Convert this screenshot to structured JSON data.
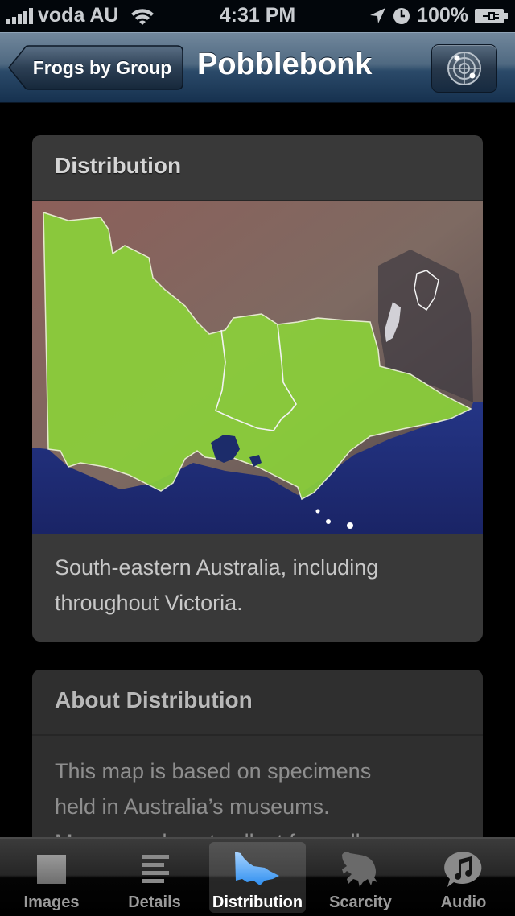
{
  "status_bar": {
    "carrier": "voda AU",
    "time": "4:31 PM",
    "battery": "100%",
    "icons": [
      "signal-bars-icon",
      "wifi-icon",
      "location-arrow-icon",
      "alarm-clock-icon",
      "battery-charging-icon"
    ]
  },
  "nav_bar": {
    "back_label": "Frogs by Group",
    "title": "Pobblebonk",
    "right_button_icon": "radar-icon"
  },
  "distribution_card": {
    "title": "Distribution",
    "map_description": "Distribution map of Victoria, south-eastern Australia, shaded green",
    "text": "South-eastern Australia, including throughout Victoria.",
    "colors": {
      "range_fill": "#8bd13a",
      "sea": "#1d2a6e",
      "land": "#7c6460"
    }
  },
  "about_card": {
    "title": "About Distribution",
    "text_lines": [
      "This map is based on specimens",
      "held in Australia’s museums.",
      "Museums do not collect from all"
    ]
  },
  "tab_bar": {
    "active": "Distribution",
    "tabs": [
      {
        "label": "Images",
        "icon": "image-square-icon"
      },
      {
        "label": "Details",
        "icon": "text-lines-icon"
      },
      {
        "label": "Distribution",
        "icon": "victoria-map-icon"
      },
      {
        "label": "Scarcity",
        "icon": "frog-icon"
      },
      {
        "label": "Audio",
        "icon": "music-note-bubble-icon"
      }
    ]
  }
}
